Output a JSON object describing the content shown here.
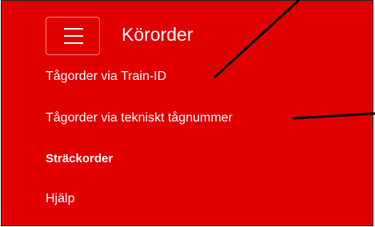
{
  "app": {
    "title": "Körorder"
  },
  "menu": {
    "toggle_icon": "hamburger-menu-icon",
    "items": [
      {
        "label": "Tågorder via Train-ID",
        "active": false
      },
      {
        "label": "Tågorder via tekniskt tågnummer",
        "active": false
      },
      {
        "label": "Sträckorder",
        "active": true
      },
      {
        "label": "Hjälp",
        "active": false
      }
    ]
  },
  "colors": {
    "background": "#e00000",
    "text": "#ffffff",
    "annotation_line": "#000000"
  }
}
